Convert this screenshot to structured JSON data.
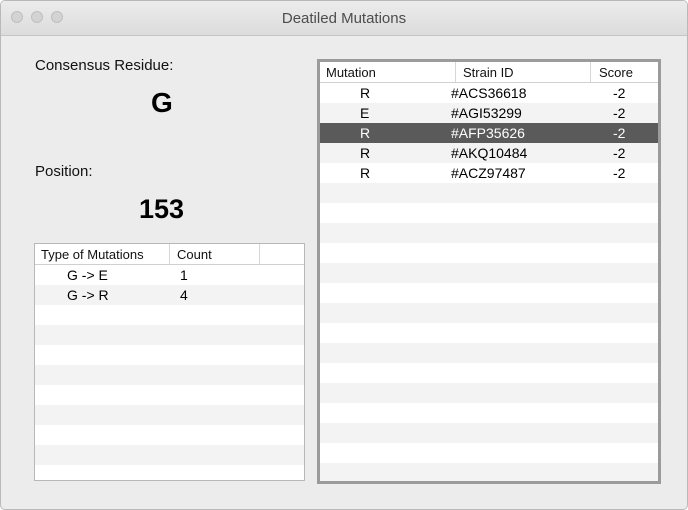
{
  "window": {
    "title": "Deatiled Mutations"
  },
  "consensus": {
    "label": "Consensus Residue:",
    "value": "G"
  },
  "position": {
    "label": "Position:",
    "value": "153"
  },
  "type_table": {
    "columns": [
      "Type of Mutations",
      "Count"
    ],
    "rows": [
      {
        "type": "G -> E",
        "count": "1"
      },
      {
        "type": "G -> R",
        "count": "4"
      }
    ]
  },
  "mutation_table": {
    "columns": [
      "Mutation",
      "Strain ID",
      "Score"
    ],
    "rows": [
      {
        "mutation": "R",
        "strain": "#ACS36618",
        "score": "-2"
      },
      {
        "mutation": "E",
        "strain": "#AGI53299",
        "score": "-2"
      },
      {
        "mutation": "R",
        "strain": "#AFP35626",
        "score": "-2"
      },
      {
        "mutation": "R",
        "strain": "#AKQ10484",
        "score": "-2"
      },
      {
        "mutation": "R",
        "strain": "#ACZ97487",
        "score": "-2"
      }
    ],
    "selected_index": 2
  },
  "colors": {
    "selection": "#5a5a5a",
    "window_bg": "#ececec"
  }
}
